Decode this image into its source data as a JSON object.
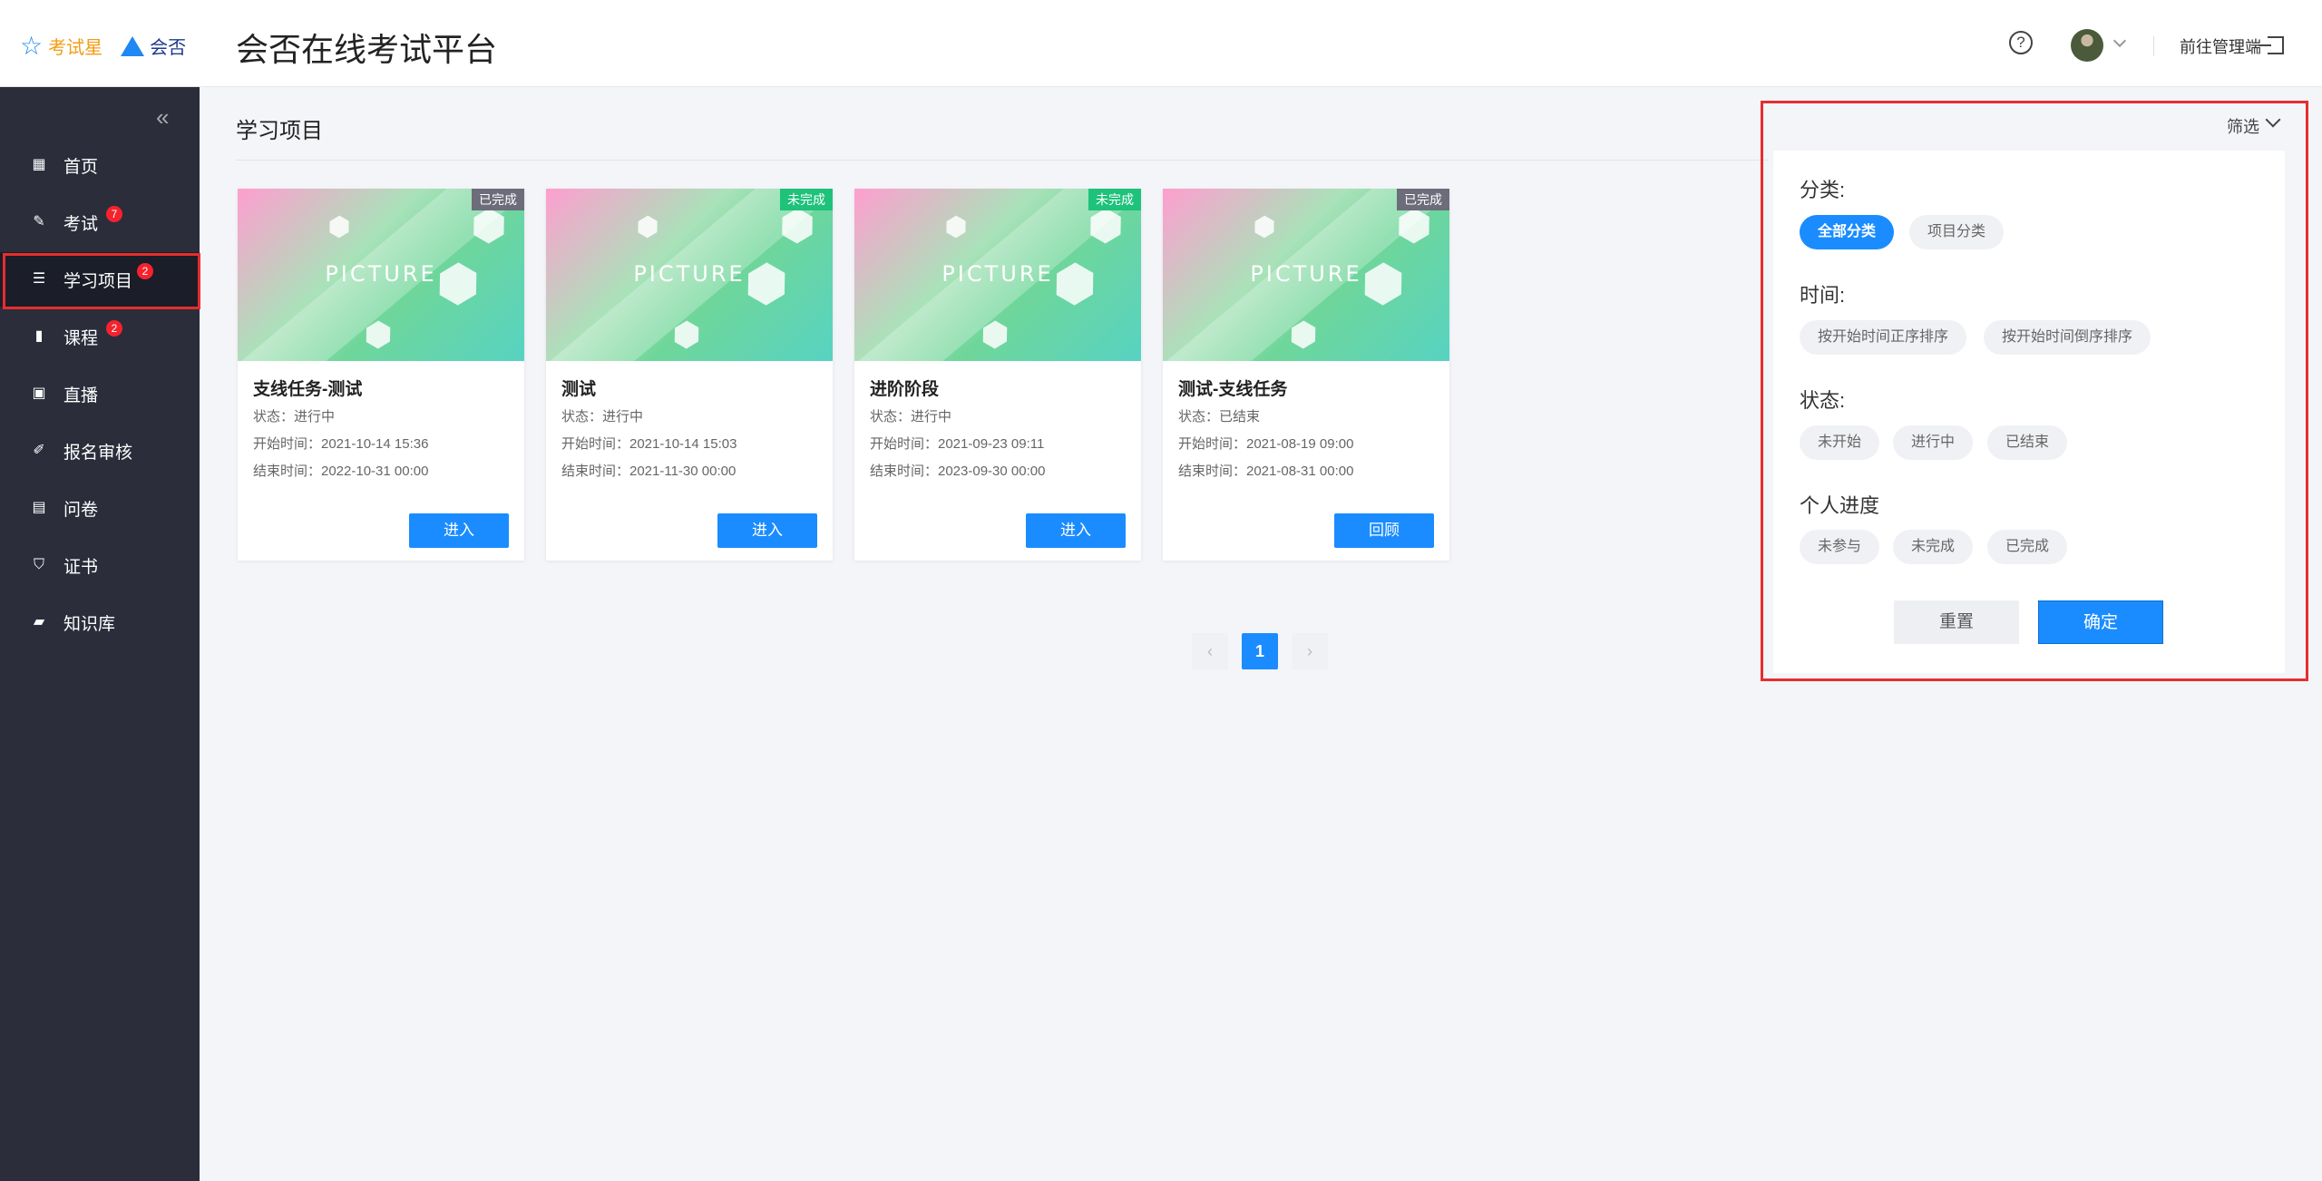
{
  "header": {
    "logo_text_1": "考试星",
    "logo_text_2": "会否",
    "title": "会否在线考试平台",
    "admin_link": "前往管理端"
  },
  "sidebar": {
    "items": [
      {
        "label": "首页",
        "icon": "grid-icon"
      },
      {
        "label": "考试",
        "icon": "edit-icon",
        "badge": "7"
      },
      {
        "label": "学习项目",
        "icon": "list-icon",
        "badge": "2"
      },
      {
        "label": "课程",
        "icon": "book-icon",
        "badge": "2"
      },
      {
        "label": "直播",
        "icon": "live-icon"
      },
      {
        "label": "报名审核",
        "icon": "signup-icon"
      },
      {
        "label": "问卷",
        "icon": "survey-icon"
      },
      {
        "label": "证书",
        "icon": "certificate-icon"
      },
      {
        "label": "知识库",
        "icon": "folder-icon"
      }
    ]
  },
  "main": {
    "section_title": "学习项目",
    "cards": [
      {
        "tag": "已完成",
        "image_text": "PICTURE",
        "title": "支线任务-测试",
        "status": "状态：进行中",
        "start": "开始时间：2021-10-14 15:36",
        "end": "结束时间：2022-10-31 00:00",
        "button": "进入"
      },
      {
        "tag": "未完成",
        "image_text": "PICTURE",
        "title": "测试",
        "status": "状态：进行中",
        "start": "开始时间：2021-10-14 15:03",
        "end": "结束时间：2021-11-30 00:00",
        "button": "进入"
      },
      {
        "tag": "未完成",
        "image_text": "PICTURE",
        "title": "进阶阶段",
        "status": "状态：进行中",
        "start": "开始时间：2021-09-23 09:11",
        "end": "结束时间：2023-09-30 00:00",
        "button": "进入"
      },
      {
        "tag": "已完成",
        "image_text": "PICTURE",
        "title": "测试-支线任务",
        "status": "状态：已结束",
        "start": "开始时间：2021-08-19 09:00",
        "end": "结束时间：2021-08-31 00:00",
        "button": "回顾"
      }
    ],
    "pagination": {
      "prev": "‹",
      "current": "1",
      "next": "›"
    }
  },
  "filter": {
    "toggle_label": "筛选",
    "category_label": "分类:",
    "category_options": [
      "全部分类",
      "项目分类"
    ],
    "time_label": "时间:",
    "time_options": [
      "按开始时间正序排序",
      "按开始时间倒序排序"
    ],
    "status_label": "状态:",
    "status_options": [
      "未开始",
      "进行中",
      "已结束"
    ],
    "progress_label": "个人进度",
    "progress_options": [
      "未参与",
      "未完成",
      "已完成"
    ],
    "reset": "重置",
    "confirm": "确定"
  },
  "colors": {
    "primary": "#1a8cff",
    "sidebar": "#2b2d3b",
    "badge": "#f5222d",
    "highlight": "#e62e2e",
    "tag_done": "#6c6c7a",
    "tag_undone": "#1ec27a"
  }
}
